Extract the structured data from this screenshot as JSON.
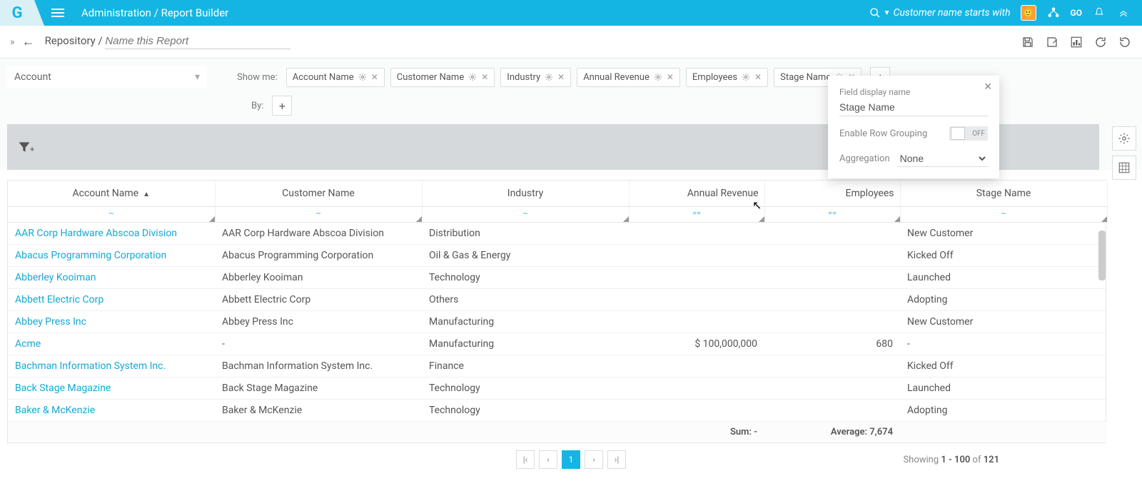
{
  "header": {
    "logo": "G",
    "breadcrumb": "Administration / Report Builder",
    "search_placeholder": "Customer name starts with",
    "go_label": "GO"
  },
  "subheader": {
    "repo_label": "Repository",
    "report_name_placeholder": "Name this Report"
  },
  "config": {
    "object": "Account",
    "show_me_label": "Show me:",
    "by_label": "By:",
    "columns": [
      {
        "label": "Account Name"
      },
      {
        "label": "Customer Name"
      },
      {
        "label": "Industry"
      },
      {
        "label": "Annual Revenue"
      },
      {
        "label": "Employees"
      },
      {
        "label": "Stage Name"
      }
    ]
  },
  "popover": {
    "field_display_label": "Field display name",
    "field_display_value": "Stage Name",
    "row_grouping_label": "Enable Row Grouping",
    "toggle_state": "OFF",
    "aggregation_label": "Aggregation",
    "aggregation_value": "None"
  },
  "table": {
    "headers": {
      "account": "Account Name",
      "customer": "Customer Name",
      "industry": "Industry",
      "revenue": "Annual Revenue",
      "employees": "Employees",
      "stage": "Stage Name"
    },
    "rows": [
      {
        "account": "AAR Corp Hardware Abscoa Division",
        "customer": "AAR Corp Hardware Abscoa Division",
        "industry": "Distribution",
        "revenue": "",
        "employees": "",
        "stage": "New Customer"
      },
      {
        "account": "Abacus Programming Corporation",
        "customer": "Abacus Programming Corporation",
        "industry": "Oil & Gas & Energy",
        "revenue": "",
        "employees": "",
        "stage": "Kicked Off"
      },
      {
        "account": "Abberley Kooiman",
        "customer": "Abberley Kooiman",
        "industry": "Technology",
        "revenue": "",
        "employees": "",
        "stage": "Launched"
      },
      {
        "account": "Abbett Electric Corp",
        "customer": "Abbett Electric Corp",
        "industry": "Others",
        "revenue": "",
        "employees": "",
        "stage": "Adopting"
      },
      {
        "account": "Abbey Press Inc",
        "customer": "Abbey Press Inc",
        "industry": "Manufacturing",
        "revenue": "",
        "employees": "",
        "stage": "New Customer"
      },
      {
        "account": "Acme",
        "customer": "-",
        "industry": "Manufacturing",
        "revenue": "$ 100,000,000",
        "employees": "680",
        "stage": "-"
      },
      {
        "account": "Bachman Information System Inc.",
        "customer": "Bachman Information System Inc.",
        "industry": "Finance",
        "revenue": "",
        "employees": "",
        "stage": "Kicked Off"
      },
      {
        "account": "Back Stage Magazine",
        "customer": "Back Stage Magazine",
        "industry": "Technology",
        "revenue": "",
        "employees": "",
        "stage": "Launched"
      },
      {
        "account": "Baker & McKenzie",
        "customer": "Baker & McKenzie",
        "industry": "Technology",
        "revenue": "",
        "employees": "",
        "stage": "Adopting"
      }
    ],
    "footer": {
      "sum_label": "Sum: -",
      "avg_label": "Average: 7,674"
    },
    "filter_text_ind": "~",
    "filter_num_ind": "=="
  },
  "pager": {
    "current": "1",
    "showing_prefix": "Showing ",
    "range": "1 - 100",
    "of": " of ",
    "total": "121"
  }
}
